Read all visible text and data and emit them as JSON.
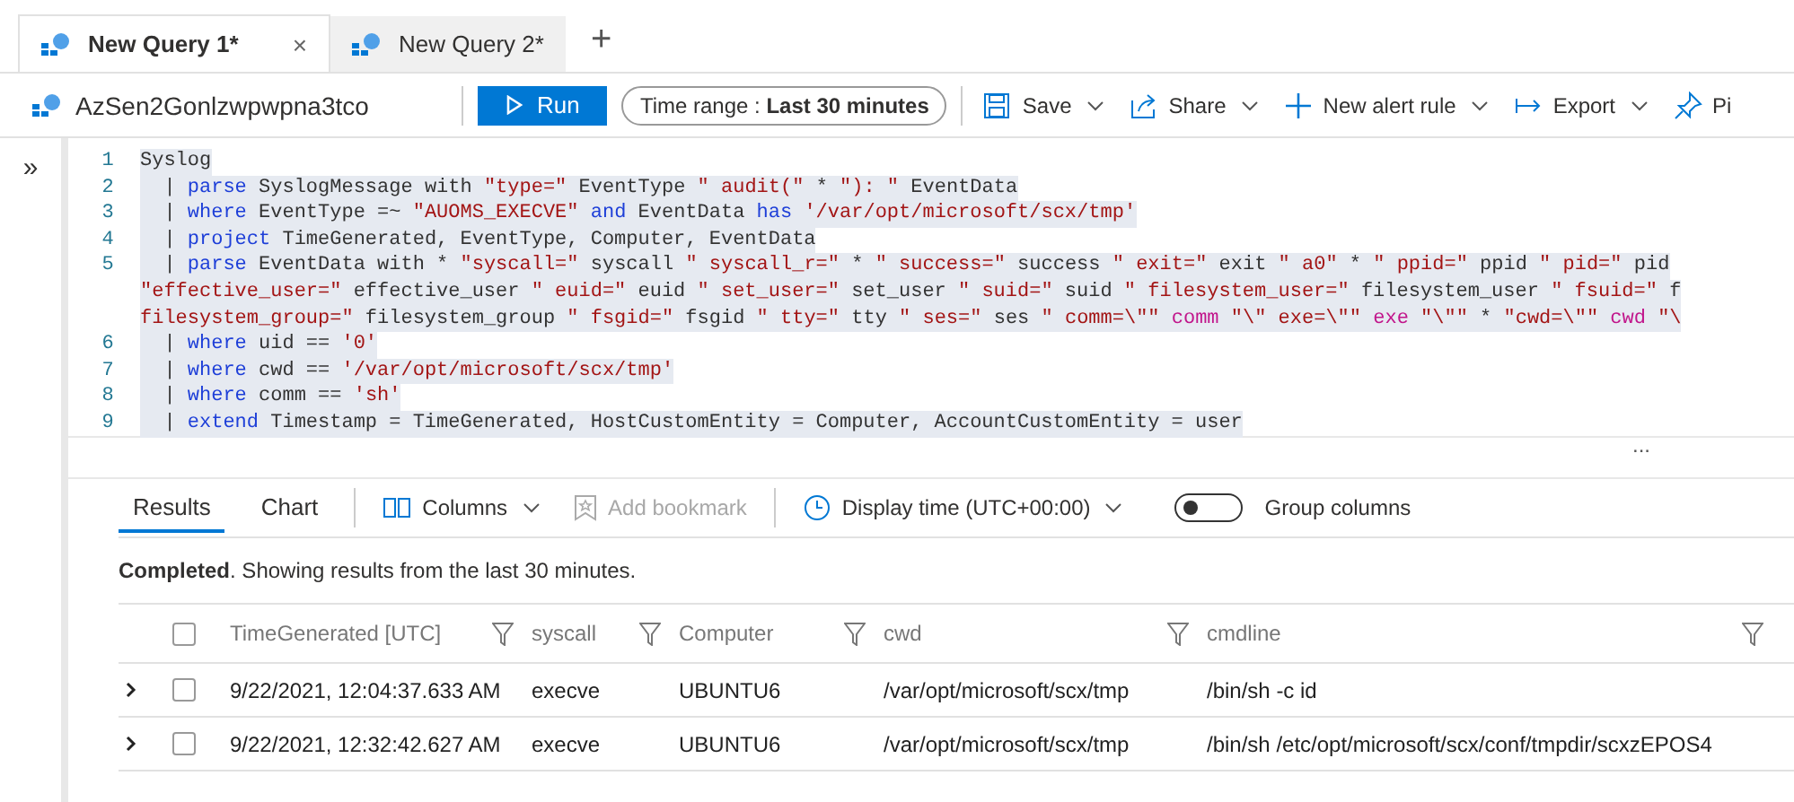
{
  "tabs": [
    {
      "label": "New Query 1*",
      "selected": true,
      "close": "×"
    },
    {
      "label": "New Query 2*",
      "selected": false
    }
  ],
  "new_tab": "+",
  "workspace": "AzSen2Gonlzwpwpna3tco",
  "run_button": "Run",
  "time_range": {
    "label": "Time range :",
    "value": "Last 30 minutes"
  },
  "toolbar": [
    {
      "kind": "save",
      "label": "Save"
    },
    {
      "kind": "share",
      "label": "Share"
    },
    {
      "kind": "alert",
      "label": "New alert rule"
    },
    {
      "kind": "export",
      "label": "Export"
    },
    {
      "kind": "pin",
      "label": "Pi"
    }
  ],
  "sidebar_toggle": "»",
  "code_lines": [
    {
      "number": "1",
      "tokens": [
        {
          "kind": "plain",
          "text": "Syslog"
        }
      ]
    },
    {
      "number": "2",
      "tokens": [
        {
          "kind": "plain",
          "text": "  | "
        },
        {
          "kind": "kw",
          "text": "parse"
        },
        {
          "kind": "plain",
          "text": " SyslogMessage with "
        },
        {
          "kind": "str",
          "text": "\"type=\""
        },
        {
          "kind": "plain",
          "text": " EventType "
        },
        {
          "kind": "str",
          "text": "\" audit(\""
        },
        {
          "kind": "plain",
          "text": " * "
        },
        {
          "kind": "str",
          "text": "\"): \""
        },
        {
          "kind": "plain",
          "text": " EventData"
        }
      ]
    },
    {
      "number": "3",
      "tokens": [
        {
          "kind": "plain",
          "text": "  | "
        },
        {
          "kind": "kw",
          "text": "where"
        },
        {
          "kind": "plain",
          "text": " EventType =~ "
        },
        {
          "kind": "str",
          "text": "\"AUOMS_EXECVE\""
        },
        {
          "kind": "kw",
          "text": " and"
        },
        {
          "kind": "plain",
          "text": " EventData "
        },
        {
          "kind": "kw",
          "text": "has"
        },
        {
          "kind": "str",
          "text": " '/var/opt/microsoft/scx/tmp'"
        }
      ]
    },
    {
      "number": "4",
      "tokens": [
        {
          "kind": "plain",
          "text": "  | "
        },
        {
          "kind": "kw",
          "text": "project"
        },
        {
          "kind": "plain",
          "text": " TimeGenerated, EventType, Computer, EventData"
        }
      ]
    },
    {
      "number": "5",
      "tokens": [
        {
          "kind": "plain",
          "text": "  | "
        },
        {
          "kind": "kw",
          "text": "parse"
        },
        {
          "kind": "plain",
          "text": " EventData with * "
        },
        {
          "kind": "str",
          "text": "\"syscall=\""
        },
        {
          "kind": "plain",
          "text": " syscall "
        },
        {
          "kind": "str",
          "text": "\" syscall_r=\""
        },
        {
          "kind": "plain",
          "text": " * "
        },
        {
          "kind": "str",
          "text": "\" success=\""
        },
        {
          "kind": "plain",
          "text": " success "
        },
        {
          "kind": "str",
          "text": "\" exit=\""
        },
        {
          "kind": "plain",
          "text": " exit "
        },
        {
          "kind": "str",
          "text": "\" a0\""
        },
        {
          "kind": "plain",
          "text": " * "
        },
        {
          "kind": "str",
          "text": "\" ppid=\""
        },
        {
          "kind": "plain",
          "text": " ppid "
        },
        {
          "kind": "str",
          "text": "\" pid=\""
        },
        {
          "kind": "plain",
          "text": " pid"
        }
      ]
    },
    {
      "tokens": [
        {
          "kind": "str",
          "text": "\"effective_user=\""
        },
        {
          "kind": "plain",
          "text": " effective_user "
        },
        {
          "kind": "str",
          "text": "\" euid=\""
        },
        {
          "kind": "plain",
          "text": " euid "
        },
        {
          "kind": "str",
          "text": "\" set_user=\""
        },
        {
          "kind": "plain",
          "text": " set_user "
        },
        {
          "kind": "str",
          "text": "\" suid=\""
        },
        {
          "kind": "plain",
          "text": " suid "
        },
        {
          "kind": "str",
          "text": "\" filesystem_user=\""
        },
        {
          "kind": "plain",
          "text": " filesystem_user "
        },
        {
          "kind": "str",
          "text": "\" fsuid=\""
        },
        {
          "kind": "plain",
          "text": " f"
        }
      ]
    },
    {
      "tokens": [
        {
          "kind": "str",
          "text": "filesystem_group=\""
        },
        {
          "kind": "plain",
          "text": " filesystem_group "
        },
        {
          "kind": "str",
          "text": "\" fsgid=\""
        },
        {
          "kind": "plain",
          "text": " fsgid "
        },
        {
          "kind": "str",
          "text": "\" tty=\""
        },
        {
          "kind": "plain",
          "text": " tty "
        },
        {
          "kind": "str",
          "text": "\" ses=\""
        },
        {
          "kind": "plain",
          "text": " ses "
        },
        {
          "kind": "str",
          "text": "\" comm=\\\"\""
        },
        {
          "kind": "var",
          "text": " comm"
        },
        {
          "kind": "str",
          "text": " \"\\\" exe=\\\"\""
        },
        {
          "kind": "var",
          "text": " exe"
        },
        {
          "kind": "str",
          "text": " \"\\\"\""
        },
        {
          "kind": "plain",
          "text": " * "
        },
        {
          "kind": "str",
          "text": "\"cwd=\\\"\""
        },
        {
          "kind": "var",
          "text": " cwd"
        },
        {
          "kind": "str",
          "text": " \"\\"
        }
      ]
    },
    {
      "number": "6",
      "tokens": [
        {
          "kind": "plain",
          "text": "  | "
        },
        {
          "kind": "kw",
          "text": "where"
        },
        {
          "kind": "plain",
          "text": " uid == "
        },
        {
          "kind": "str",
          "text": "'0'"
        }
      ]
    },
    {
      "number": "7",
      "tokens": [
        {
          "kind": "plain",
          "text": "  | "
        },
        {
          "kind": "kw",
          "text": "where"
        },
        {
          "kind": "plain",
          "text": " cwd == "
        },
        {
          "kind": "str",
          "text": "'/var/opt/microsoft/scx/tmp'"
        }
      ]
    },
    {
      "number": "8",
      "tokens": [
        {
          "kind": "plain",
          "text": "  | "
        },
        {
          "kind": "kw",
          "text": "where"
        },
        {
          "kind": "plain",
          "text": " comm == "
        },
        {
          "kind": "str",
          "text": "'sh'"
        }
      ]
    },
    {
      "number": "9",
      "tokens": [
        {
          "kind": "plain",
          "text": "  | "
        },
        {
          "kind": "kw",
          "text": "extend"
        },
        {
          "kind": "plain",
          "text": " Timestamp = TimeGenerated, HostCustomEntity = Computer, AccountCustomEntity = user"
        }
      ]
    }
  ],
  "splitter": "...",
  "result_tabs": [
    {
      "label": "Results",
      "selected": true
    },
    {
      "label": "Chart",
      "selected": false
    }
  ],
  "result_tools": {
    "columns": "Columns",
    "bookmark": {
      "label": "Add bookmark",
      "disabled": true
    },
    "display_time": "Display time (UTC+00:00)",
    "group_columns": {
      "label": "Group columns",
      "on": false
    }
  },
  "status": "**Completed**. Showing results from the last 30 minutes.",
  "table": {
    "all_checked": false,
    "columns": [
      "TimeGenerated [UTC]",
      "syscall",
      "Computer",
      "cwd",
      "cmdline"
    ],
    "rows": [
      {
        "checked": false,
        "cells": [
          "9/22/2021, 12:04:37.633 AM",
          "execve",
          "UBUNTU6",
          "/var/opt/microsoft/scx/tmp",
          "/bin/sh -c id"
        ]
      },
      {
        "checked": false,
        "cells": [
          "9/22/2021, 12:32:42.627 AM",
          "execve",
          "UBUNTU6",
          "/var/opt/microsoft/scx/tmp",
          "/bin/sh /etc/opt/microsoft/scx/conf/tmpdir/scxzEPOS4"
        ]
      }
    ]
  }
}
